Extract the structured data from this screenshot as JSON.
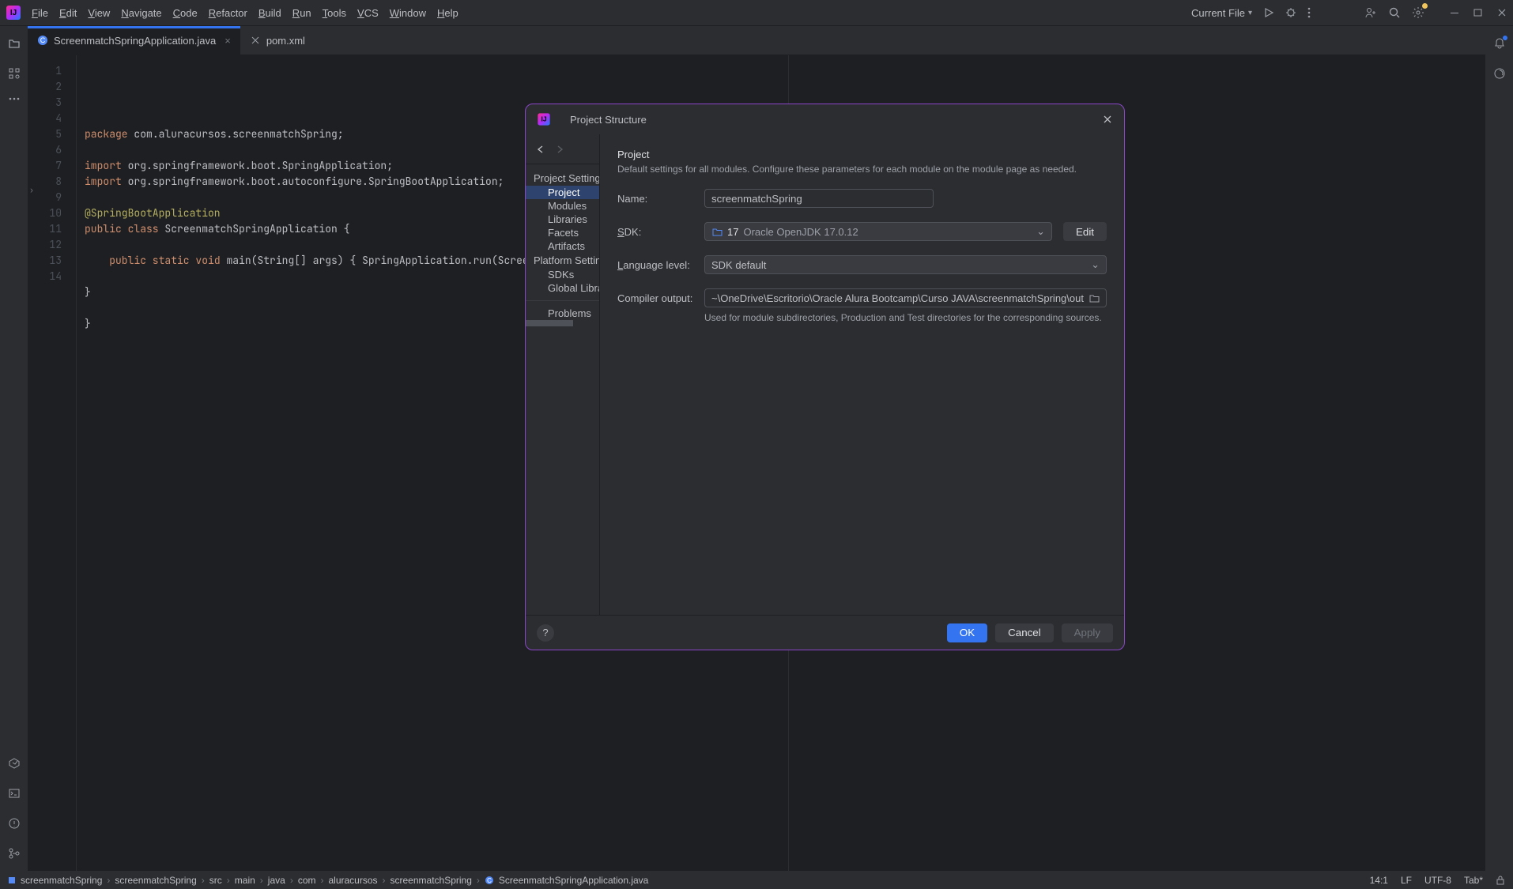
{
  "menu": [
    "File",
    "Edit",
    "View",
    "Navigate",
    "Code",
    "Refactor",
    "Build",
    "Run",
    "Tools",
    "VCS",
    "Window",
    "Help"
  ],
  "run_target": "Current File",
  "tabs": [
    {
      "name": "ScreenmatchSpringApplication.java",
      "active": true,
      "icon": "class"
    },
    {
      "name": "pom.xml",
      "active": false,
      "icon": "xml"
    }
  ],
  "code_lines": [
    {
      "n": 1,
      "html": "<span class='kw'>package</span> <span class='pkg'>com.aluracursos.screenmatchSpring;</span>"
    },
    {
      "n": 2,
      "html": ""
    },
    {
      "n": 3,
      "html": "<span class='kw'>import</span> <span class='pkg'>org.springframework.boot.SpringApplication;</span>"
    },
    {
      "n": 4,
      "html": "<span class='kw'>import</span> <span class='pkg'>org.springframework.boot.autoconfigure.SpringBootApplication;</span>"
    },
    {
      "n": 5,
      "html": ""
    },
    {
      "n": 6,
      "html": "<span class='ann'>@SpringBootApplication</span>"
    },
    {
      "n": 7,
      "html": "<span class='kw'>public class</span> <span class='pkg'>ScreenmatchSpringApplication {</span>"
    },
    {
      "n": 8,
      "html": ""
    },
    {
      "n": 9,
      "html": "    <span class='kw'>public static</span> <span class='kw'>void</span> <span class='pkg'>main(String[] args) {</span> <span class='pkg'>SpringApplication.run(Screenmat</span>"
    },
    {
      "n": 10,
      "html": ""
    },
    {
      "n": 11,
      "html": "<span class='pkg'>}</span>"
    },
    {
      "n": 12,
      "html": ""
    },
    {
      "n": 13,
      "html": "<span class='pkg'>}</span>"
    },
    {
      "n": 14,
      "html": ""
    }
  ],
  "breadcrumbs": [
    "screenmatchSpring",
    "screenmatchSpring",
    "src",
    "main",
    "java",
    "com",
    "aluracursos",
    "screenmatchSpring",
    "ScreenmatchSpringApplication.java"
  ],
  "status": {
    "pos": "14:1",
    "sep": "LF",
    "enc": "UTF-8",
    "indent": "Tab*"
  },
  "modal": {
    "title": "Project Structure",
    "sidebar": {
      "heading1": "Project Settings",
      "items1": [
        "Project",
        "Modules",
        "Libraries",
        "Facets",
        "Artifacts"
      ],
      "heading2": "Platform Settings",
      "items2": [
        "SDKs",
        "Global Libraries"
      ],
      "problems": "Problems"
    },
    "content": {
      "title": "Project",
      "desc": "Default settings for all modules. Configure these parameters for each module on the module page as needed.",
      "name_label": "Name:",
      "name_value": "screenmatchSpring",
      "sdk_label": "SDK:",
      "sdk_value_bold": "17",
      "sdk_value_rest": "Oracle OpenJDK 17.0.12",
      "edit_btn": "Edit",
      "lang_label": "Language level:",
      "lang_value": "SDK default",
      "compiler_label": "Compiler output:",
      "compiler_value": "~\\OneDrive\\Escritorio\\Oracle Alura Bootcamp\\Curso JAVA\\screenmatchSpring\\out",
      "compiler_help": "Used for module subdirectories, Production and Test directories for the corresponding sources."
    },
    "footer": {
      "ok": "OK",
      "cancel": "Cancel",
      "apply": "Apply"
    }
  }
}
